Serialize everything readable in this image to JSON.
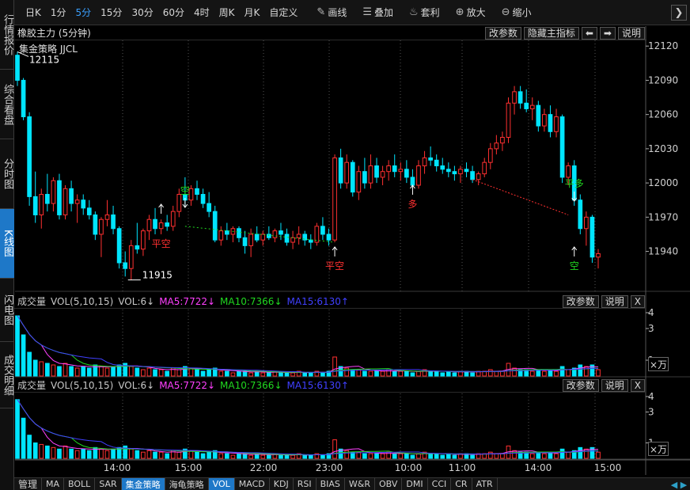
{
  "sidebar": {
    "tabs": [
      {
        "label": "行情报价",
        "active": false
      },
      {
        "label": "综合看盘",
        "active": false
      },
      {
        "label": "分时图",
        "active": false
      },
      {
        "label": "K线图",
        "active": true
      },
      {
        "label": "闪电图",
        "active": false
      },
      {
        "label": "成交明细",
        "active": false
      }
    ]
  },
  "toolbar": {
    "periods": [
      {
        "label": "日K",
        "selected": false
      },
      {
        "label": "1分",
        "selected": false
      },
      {
        "label": "5分",
        "selected": true
      },
      {
        "label": "15分",
        "selected": false
      },
      {
        "label": "30分",
        "selected": false
      },
      {
        "label": "60分",
        "selected": false
      },
      {
        "label": "4时",
        "selected": false
      },
      {
        "label": "周K",
        "selected": false
      },
      {
        "label": "月K",
        "selected": false
      },
      {
        "label": "自定义",
        "selected": false
      }
    ],
    "tools": [
      {
        "label": "画线",
        "icon": "pencil-icon"
      },
      {
        "label": "叠加",
        "icon": "stack-icon"
      },
      {
        "label": "套利",
        "icon": "money-bag-icon"
      },
      {
        "label": "放大",
        "icon": "zoom-in-icon"
      },
      {
        "label": "缩小",
        "icon": "zoom-out-icon"
      }
    ],
    "collapse_glyph": "❯"
  },
  "main_panel": {
    "title": "橡胶主力 (5分钟)",
    "strategy_label": "集金策略 JJCL",
    "buttons": {
      "edit_params": "改参数",
      "hide_indicator": "隐藏主指标",
      "prev": "⬅",
      "next": "➡",
      "help": "说明"
    },
    "price_axis": [
      "12120",
      "12090",
      "12060",
      "12030",
      "12000",
      "11970",
      "11940"
    ],
    "high_label": "12115",
    "low_label": "11915",
    "signals": {
      "ping_kong": "平空",
      "kong": "空",
      "duo": "多",
      "ping_duo": "平多"
    }
  },
  "vol_panel_1": {
    "legend": {
      "name": "成交量",
      "params": "VOL(5,10,15)",
      "vol": "VOL:6↓",
      "ma5": "MA5:7722↓",
      "ma10": "MA10:7366↓",
      "ma15": "MA15:6130↑"
    },
    "buttons": {
      "edit_params": "改参数",
      "help": "说明",
      "close": "X"
    },
    "axis": [
      "4",
      "3",
      "1"
    ],
    "unit": "×万"
  },
  "vol_panel_2": {
    "legend": {
      "name": "成交量",
      "params": "VOL(5,10,15)",
      "vol": "VOL:6↓",
      "ma5": "MA5:7722↓",
      "ma10": "MA10:7366↓",
      "ma15": "MA15:6130↑"
    },
    "buttons": {
      "edit_params": "改参数",
      "help": "说明",
      "close": "X"
    },
    "axis": [
      "4",
      "3",
      "1"
    ],
    "unit": "×万"
  },
  "time_axis": [
    "14:00",
    "15:00",
    "22:00",
    "23:00",
    "10:00",
    "11:00",
    "14:00",
    "15:00"
  ],
  "bottom_bar": {
    "manage": "管理",
    "indicators": [
      {
        "label": "MA",
        "selected": false
      },
      {
        "label": "BOLL",
        "selected": false
      },
      {
        "label": "SAR",
        "selected": false
      },
      {
        "label": "集金策略",
        "selected": true
      },
      {
        "label": "海龟策略",
        "selected": false
      },
      {
        "label": "VOL",
        "selected": true
      },
      {
        "label": "MACD",
        "selected": false
      },
      {
        "label": "KDJ",
        "selected": false
      },
      {
        "label": "RSI",
        "selected": false
      },
      {
        "label": "BIAS",
        "selected": false
      },
      {
        "label": "W&R",
        "selected": false
      },
      {
        "label": "OBV",
        "selected": false
      },
      {
        "label": "DMI",
        "selected": false
      },
      {
        "label": "CCI",
        "selected": false
      },
      {
        "label": "CR",
        "selected": false
      },
      {
        "label": "ATR",
        "selected": false
      }
    ],
    "scroll_left": "◀",
    "scroll_right": "▶"
  },
  "colors": {
    "up": "#ff3030",
    "down": "#00e5ff",
    "ma5": "#ff40ff",
    "ma10": "#20d820",
    "ma15": "#4040ff",
    "signal_red": "#ff3030",
    "signal_green": "#20d820",
    "dots": "#20d820"
  },
  "chart_data": [
    {
      "type": "candlestick",
      "title": "橡胶主力 (5分钟)",
      "ylim": [
        11905,
        12125
      ],
      "candles": [
        [
          12112,
          12115,
          12085,
          12090
        ],
        [
          12090,
          12092,
          12055,
          12058
        ],
        [
          12058,
          12062,
          11980,
          11988
        ],
        [
          11988,
          12010,
          11965,
          11972
        ],
        [
          11972,
          11995,
          11960,
          11990
        ],
        [
          11990,
          12008,
          11975,
          11982
        ],
        [
          11982,
          12005,
          11975,
          12002
        ],
        [
          12002,
          12008,
          11968,
          11972
        ],
        [
          11972,
          11998,
          11968,
          11995
        ],
        [
          11995,
          12002,
          11975,
          11982
        ],
        [
          11982,
          11990,
          11965,
          11985
        ],
        [
          11985,
          11990,
          11972,
          11978
        ],
        [
          11978,
          11985,
          11968,
          11972
        ],
        [
          11972,
          11975,
          11950,
          11955
        ],
        [
          11955,
          11970,
          11935,
          11968
        ],
        [
          11968,
          11985,
          11962,
          11972
        ],
        [
          11972,
          11980,
          11955,
          11960
        ],
        [
          11960,
          11962,
          11925,
          11930
        ],
        [
          11930,
          11940,
          11918,
          11925
        ],
        [
          11925,
          11950,
          11915,
          11945
        ],
        [
          11945,
          11965,
          11938,
          11942
        ],
        [
          11942,
          11960,
          11936,
          11958
        ],
        [
          11958,
          11972,
          11950,
          11968
        ],
        [
          11968,
          11978,
          11955,
          11960
        ],
        [
          11960,
          11968,
          11955,
          11965
        ],
        [
          11965,
          11972,
          11958,
          11962
        ],
        [
          11962,
          11980,
          11958,
          11975
        ],
        [
          11975,
          11995,
          11970,
          11990
        ],
        [
          11990,
          12005,
          11980,
          11985
        ],
        [
          11985,
          11998,
          11980,
          11995
        ],
        [
          11995,
          12002,
          11985,
          11990
        ],
        [
          11990,
          11995,
          11978,
          11982
        ],
        [
          11982,
          11992,
          11970,
          11975
        ],
        [
          11975,
          11980,
          11948,
          11950
        ],
        [
          11950,
          11962,
          11945,
          11958
        ],
        [
          11958,
          11965,
          11950,
          11955
        ],
        [
          11955,
          11962,
          11948,
          11960
        ],
        [
          11960,
          11962,
          11948,
          11952
        ],
        [
          11952,
          11958,
          11938,
          11945
        ],
        [
          11945,
          11960,
          11935,
          11955
        ],
        [
          11955,
          11962,
          11948,
          11950
        ],
        [
          11950,
          11958,
          11945,
          11955
        ],
        [
          11955,
          11962,
          11950,
          11952
        ],
        [
          11952,
          11960,
          11948,
          11958
        ],
        [
          11958,
          11965,
          11950,
          11955
        ],
        [
          11955,
          11960,
          11945,
          11948
        ],
        [
          11948,
          11958,
          11942,
          11952
        ],
        [
          11952,
          11962,
          11946,
          11955
        ],
        [
          11955,
          11958,
          11945,
          11950
        ],
        [
          11950,
          11955,
          11942,
          11948
        ],
        [
          11948,
          11965,
          11945,
          11962
        ],
        [
          11962,
          11970,
          11950,
          11955
        ],
        [
          11955,
          11960,
          11945,
          11950
        ],
        [
          11950,
          12025,
          11948,
          12022
        ],
        [
          12022,
          12030,
          11995,
          12000
        ],
        [
          12000,
          12025,
          11995,
          12018
        ],
        [
          12018,
          12020,
          11988,
          11992
        ],
        [
          11992,
          12015,
          11985,
          12010
        ],
        [
          12010,
          12022,
          11995,
          12000
        ],
        [
          12000,
          12025,
          11995,
          12015
        ],
        [
          12015,
          12022,
          12000,
          12005
        ],
        [
          12005,
          12015,
          11998,
          12010
        ],
        [
          12010,
          12020,
          12002,
          12015
        ],
        [
          12015,
          12025,
          12005,
          12010
        ],
        [
          12010,
          12018,
          12002,
          12012
        ],
        [
          12012,
          12020,
          12000,
          12005
        ],
        [
          12005,
          12012,
          11995,
          11998
        ],
        [
          11998,
          12020,
          11995,
          12015
        ],
        [
          12015,
          12028,
          12008,
          12022
        ],
        [
          12022,
          12032,
          12015,
          12020
        ],
        [
          12020,
          12025,
          12010,
          12015
        ],
        [
          12015,
          12022,
          12008,
          12012
        ],
        [
          12012,
          12018,
          12005,
          12010
        ],
        [
          12010,
          12015,
          12002,
          12008
        ],
        [
          12008,
          12015,
          12000,
          12012
        ],
        [
          12012,
          12018,
          12005,
          12010
        ],
        [
          12010,
          12015,
          12000,
          12003
        ],
        [
          12003,
          12010,
          11998,
          12008
        ],
        [
          12008,
          12022,
          12005,
          12018
        ],
        [
          12018,
          12035,
          12012,
          12030
        ],
        [
          12030,
          12042,
          12025,
          12035
        ],
        [
          12035,
          12045,
          12028,
          12040
        ],
        [
          12040,
          12075,
          12035,
          12070
        ],
        [
          12070,
          12085,
          12060,
          12080
        ],
        [
          12080,
          12085,
          12065,
          12070
        ],
        [
          12070,
          12082,
          12062,
          12065
        ],
        [
          12065,
          12075,
          12055,
          12068
        ],
        [
          12068,
          12072,
          12045,
          12050
        ],
        [
          12050,
          12065,
          12045,
          12060
        ],
        [
          12060,
          12068,
          12040,
          12045
        ],
        [
          12045,
          12065,
          12040,
          12058
        ],
        [
          12058,
          12060,
          12000,
          12005
        ],
        [
          12005,
          12018,
          11998,
          12015
        ],
        [
          12015,
          12020,
          11980,
          11985
        ],
        [
          11985,
          11990,
          11955,
          11960
        ],
        [
          11960,
          11975,
          11945,
          11970
        ],
        [
          11970,
          11972,
          11930,
          11935
        ],
        [
          11935,
          11942,
          11925,
          11938
        ]
      ],
      "volume": [
        3.8,
        2.6,
        1.5,
        1.0,
        0.9,
        0.8,
        0.7,
        0.6,
        0.8,
        0.6,
        0.5,
        0.6,
        0.5,
        0.7,
        0.6,
        0.5,
        0.6,
        0.7,
        0.8,
        0.6,
        0.5,
        0.4,
        0.5,
        0.4,
        0.4,
        0.3,
        0.5,
        0.4,
        0.6,
        0.5,
        0.4,
        0.3,
        0.4,
        0.5,
        0.3,
        0.3,
        0.2,
        0.3,
        0.3,
        0.2,
        0.3,
        0.2,
        0.2,
        0.3,
        0.2,
        0.2,
        0.2,
        0.3,
        0.2,
        0.2,
        0.3,
        0.2,
        0.3,
        1.2,
        0.6,
        0.5,
        0.4,
        0.4,
        0.3,
        0.3,
        0.3,
        0.3,
        0.4,
        0.3,
        0.3,
        0.3,
        0.2,
        0.3,
        0.4,
        0.3,
        0.3,
        0.2,
        0.3,
        0.2,
        0.3,
        0.3,
        0.2,
        0.3,
        0.3,
        0.4,
        0.3,
        0.3,
        0.8,
        0.5,
        0.4,
        0.4,
        0.3,
        0.4,
        0.3,
        0.4,
        0.3,
        0.6,
        0.4,
        0.5,
        0.7,
        0.6,
        0.7,
        0.4
      ],
      "ma_lines": {
        "MA5": "magenta",
        "MA10": "green",
        "MA15": "blue"
      }
    }
  ]
}
